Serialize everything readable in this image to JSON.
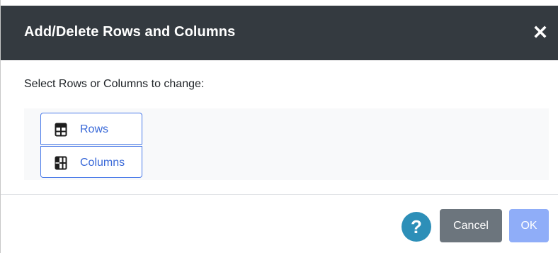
{
  "dialog": {
    "title": "Add/Delete Rows and Columns",
    "close_icon": "close-icon",
    "prompt": "Select Rows or Columns to change:",
    "options": [
      {
        "label": "Rows",
        "icon": "table-rows-icon",
        "selected": false
      },
      {
        "label": "Columns",
        "icon": "table-columns-icon",
        "selected": false
      }
    ],
    "footer": {
      "help_icon": "help-icon",
      "help_symbol": "?",
      "cancel_label": "Cancel",
      "ok_label": "OK",
      "ok_enabled": false
    },
    "colors": {
      "header_bg": "#343a40",
      "accent": "#3868d8",
      "help_bg": "#2d8fb8",
      "cancel_bg": "#6c757d",
      "ok_bg_disabled": "#8fadf8"
    }
  }
}
